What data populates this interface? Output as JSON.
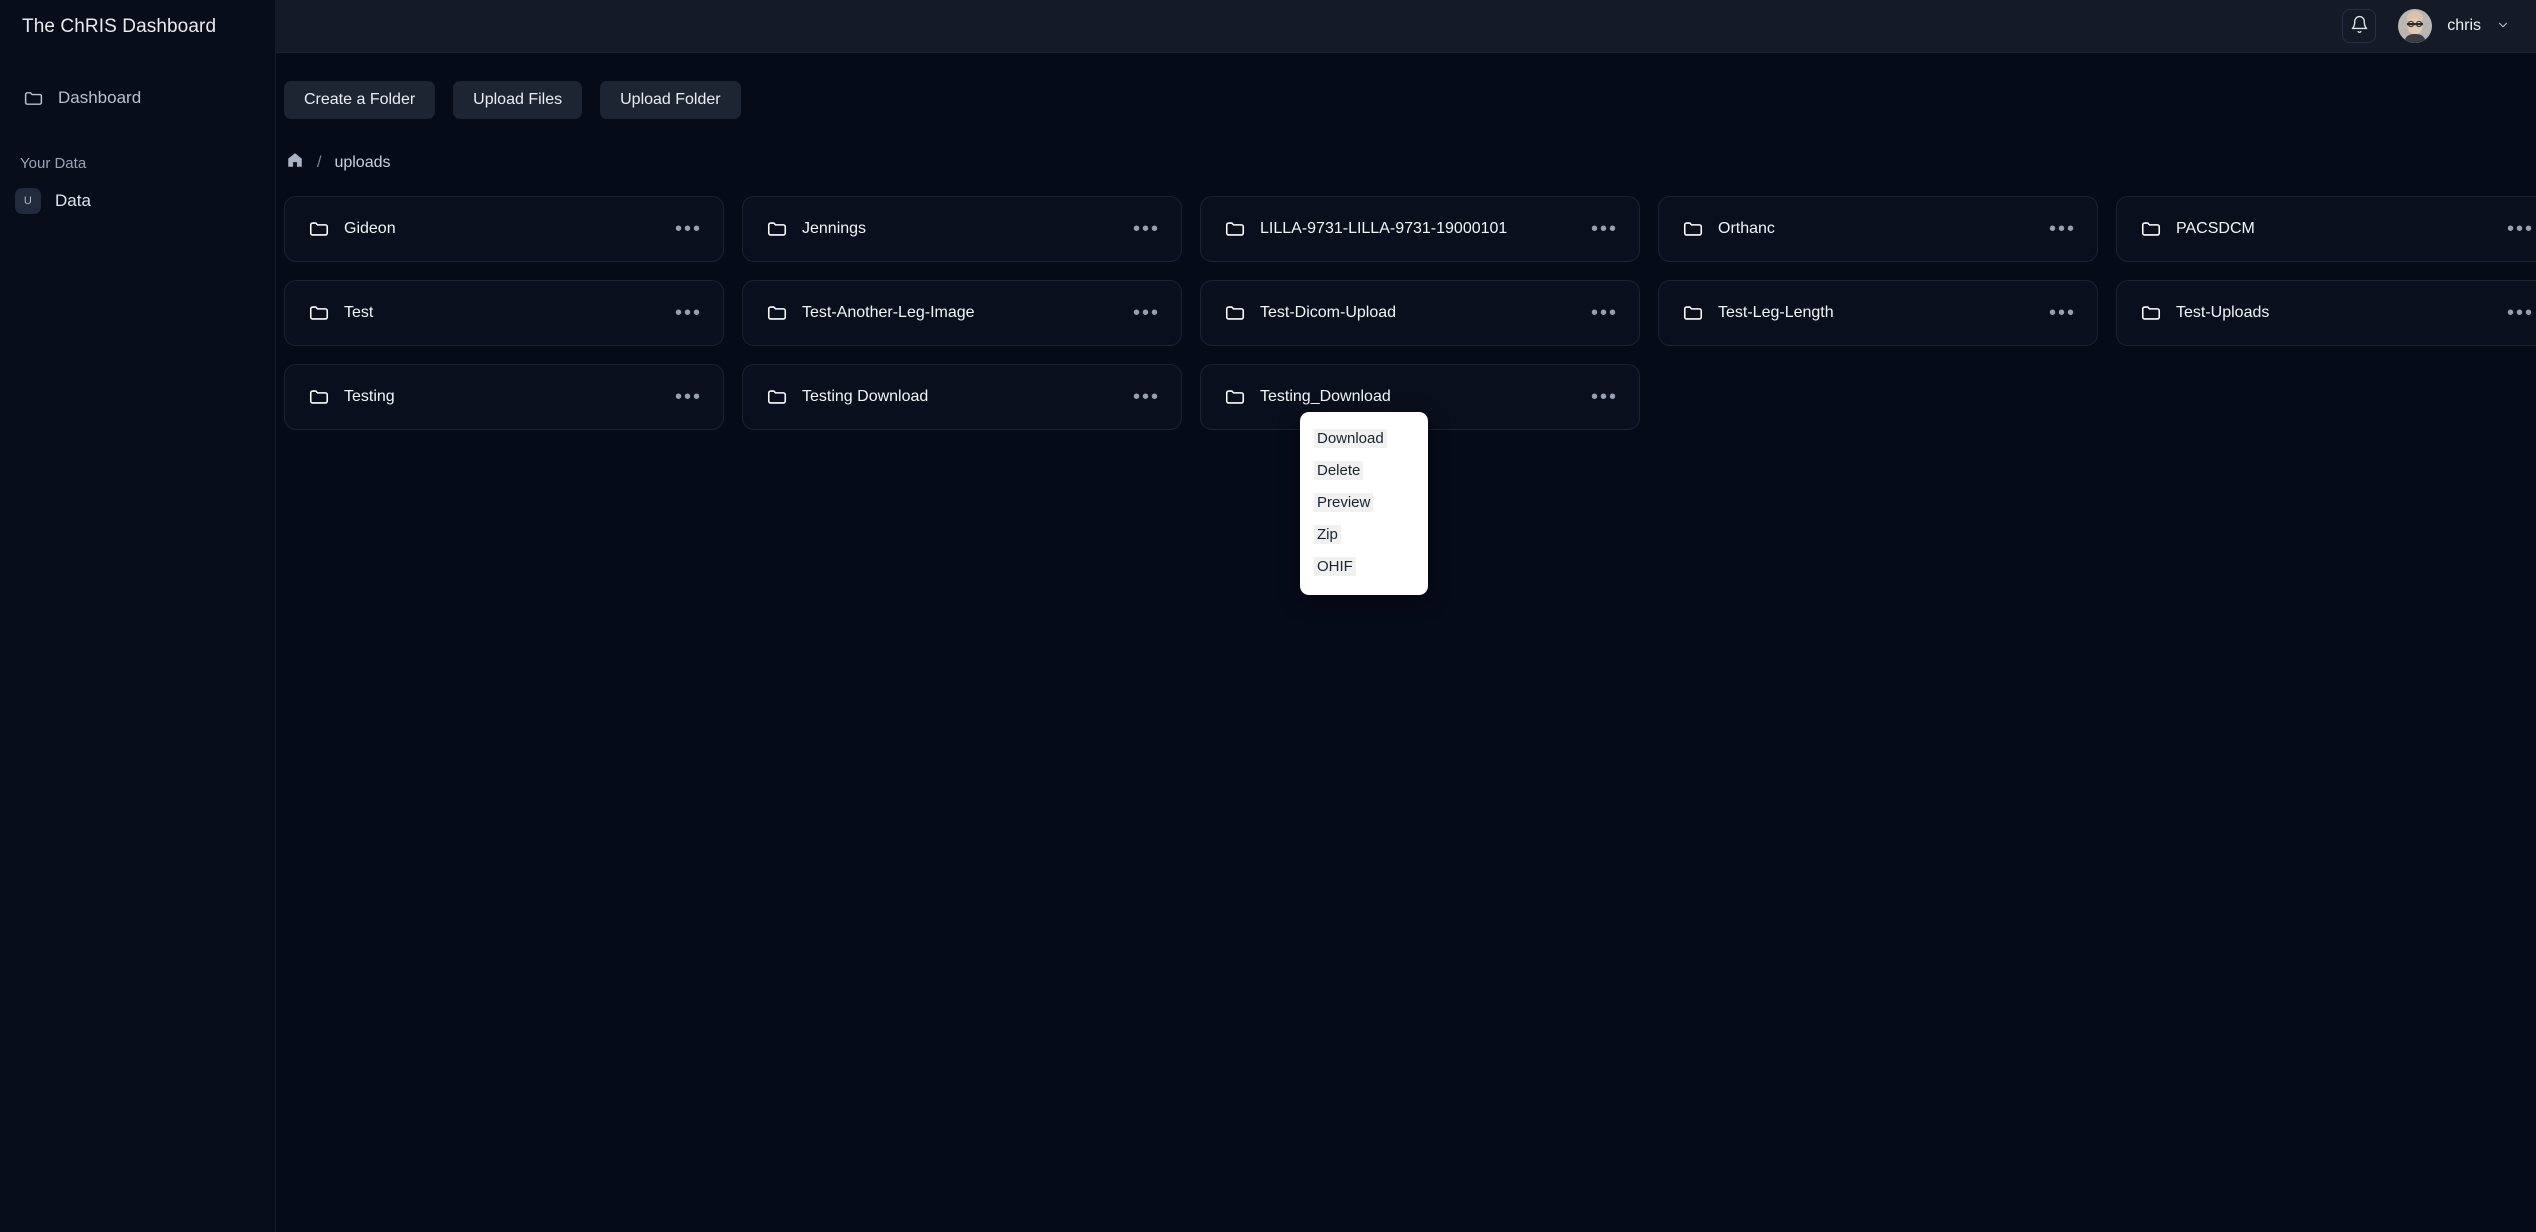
{
  "sidebar": {
    "brand": "The ChRIS Dashboard",
    "nav": [
      {
        "label": "Dashboard",
        "icon": "folder-icon"
      }
    ],
    "section_label": "Your Data",
    "data_item": {
      "label": "Data",
      "badge": "U"
    }
  },
  "topbar": {
    "notifications_icon": "bell-icon",
    "username": "chris",
    "chevron_icon": "chevron-down-icon",
    "avatar_icon": "user-avatar"
  },
  "toolbar": {
    "create_folder": "Create a Folder",
    "upload_files": "Upload Files",
    "upload_folder": "Upload Folder"
  },
  "breadcrumb": {
    "home_icon": "home-icon",
    "separator": "/",
    "current": "uploads"
  },
  "folders": [
    {
      "name": "Gideon"
    },
    {
      "name": "Jennings"
    },
    {
      "name": "LILLA-9731-LILLA-9731-19000101"
    },
    {
      "name": "Orthanc"
    },
    {
      "name": "PACSDCM"
    },
    {
      "name": "Test"
    },
    {
      "name": "Test-Another-Leg-Image"
    },
    {
      "name": "Test-Dicom-Upload"
    },
    {
      "name": "Test-Leg-Length"
    },
    {
      "name": "Test-Uploads"
    },
    {
      "name": "Testing"
    },
    {
      "name": "Testing Download"
    },
    {
      "name": "Testing_Download"
    }
  ],
  "context_menu": {
    "items": [
      {
        "label": "Download"
      },
      {
        "label": "Delete"
      },
      {
        "label": "Preview"
      },
      {
        "label": "Zip"
      },
      {
        "label": "OHIF"
      }
    ]
  },
  "colors": {
    "page_bg": "#060b18",
    "sidebar_bg": "#080d1a",
    "topbar_bg": "#141a26",
    "card_bg": "#090f1d",
    "card_border": "#1b2230",
    "button_bg": "#1d2533",
    "menu_bg": "#ffffff",
    "text_primary": "#f2f5f9",
    "text_muted": "#aeb7c5"
  }
}
